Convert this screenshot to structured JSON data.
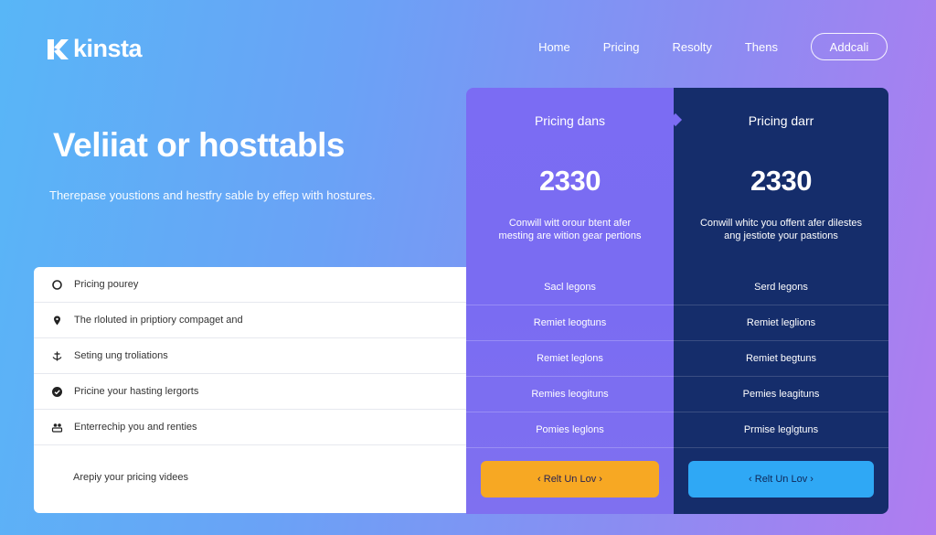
{
  "header": {
    "logo_text": "kinsta",
    "nav": [
      "Home",
      "Pricing",
      "Resolty",
      "Thens"
    ],
    "cta_label": "Addcali"
  },
  "hero": {
    "title": "Veliiat or hosttabls",
    "subtitle": "Therepase youstions and hestfry sable by effep with hostures."
  },
  "features": {
    "items": [
      {
        "icon": "circle-icon",
        "label": "Pricing pourey"
      },
      {
        "icon": "map-pin-icon",
        "label": "The rloluted in priptiory compaget and"
      },
      {
        "icon": "anchor-icon",
        "label": "Seting ung troliations"
      },
      {
        "icon": "check-circle-icon",
        "label": "Pricine your hasting lergorts"
      },
      {
        "icon": "users-icon",
        "label": "Enterrechip you and renties"
      }
    ],
    "footer_text": "Arepiy your pricing videes"
  },
  "plans": [
    {
      "name": "Pricing dans",
      "price": "2330",
      "description": "Conwill witt orour btent afer mesting are wition gear pertions",
      "rows": [
        "Sacl legons",
        "Remiet leogtuns",
        "Remiet leglons",
        "Remies leogituns",
        "Pomies leglons"
      ],
      "button_label": "‹ Relt Un Lov ›"
    },
    {
      "name": "Pricing darr",
      "price": "2330",
      "description": "Conwill whitc you offent afer dilestes ang jestiote your pastions",
      "rows": [
        "Serd legons",
        "Remiet leglions",
        "Remiet begtuns",
        "Pemies leagituns",
        "Prmise leglgtuns"
      ],
      "button_label": "‹ Relt Un Lov ›"
    }
  ],
  "colors": {
    "plan1_bg": "#7b6cf3",
    "plan2_bg": "#152d6b",
    "plan1_button": "#f7a823",
    "plan2_button": "#2fa8f5"
  }
}
